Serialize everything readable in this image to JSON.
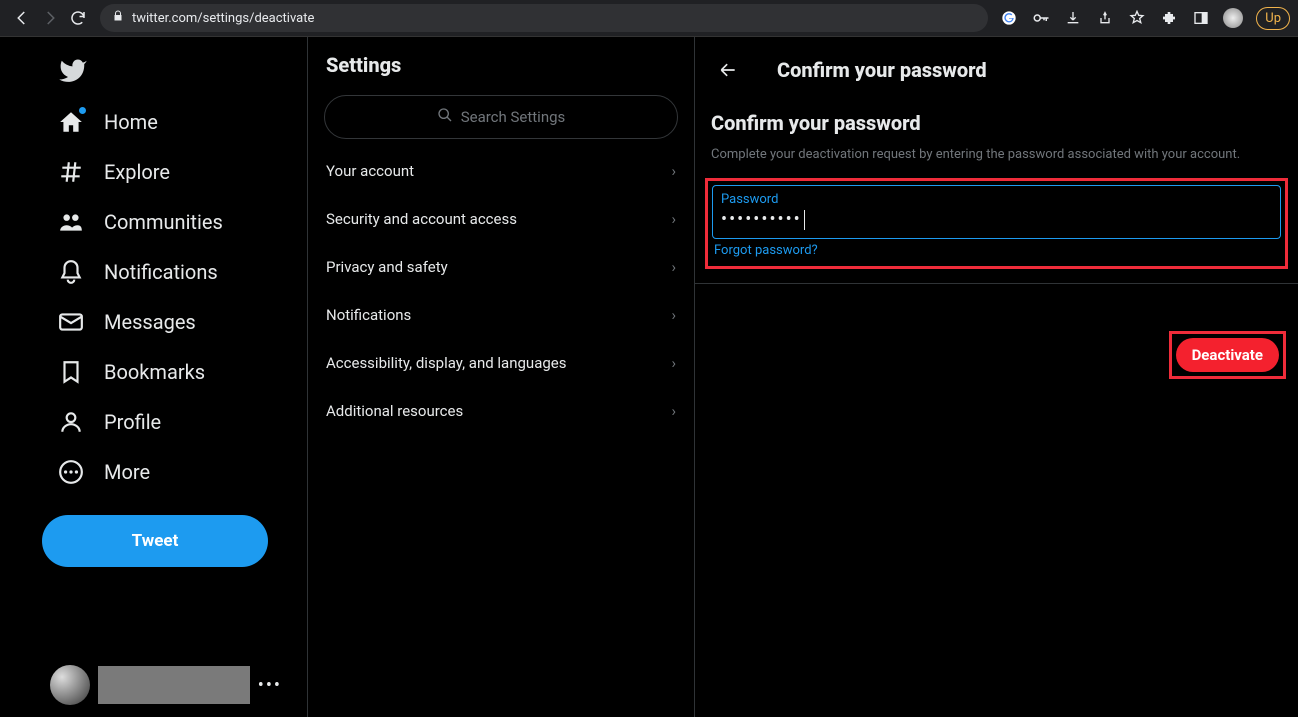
{
  "browser": {
    "url": "twitter.com/settings/deactivate",
    "update_label": "Up"
  },
  "nav": {
    "home": "Home",
    "explore": "Explore",
    "communities": "Communities",
    "notifications": "Notifications",
    "messages": "Messages",
    "bookmarks": "Bookmarks",
    "profile": "Profile",
    "more": "More",
    "tweet": "Tweet"
  },
  "settings": {
    "title": "Settings",
    "search_placeholder": "Search Settings",
    "items": [
      "Your account",
      "Security and account access",
      "Privacy and safety",
      "Notifications",
      "Accessibility, display, and languages",
      "Additional resources"
    ]
  },
  "main": {
    "header_title": "Confirm your password",
    "section_title": "Confirm your password",
    "help_text": "Complete your deactivation request by entering the password associated with your account.",
    "password_label": "Password",
    "password_value": "••••••••••",
    "forgot_link": "Forgot password?",
    "deactivate_label": "Deactivate"
  }
}
